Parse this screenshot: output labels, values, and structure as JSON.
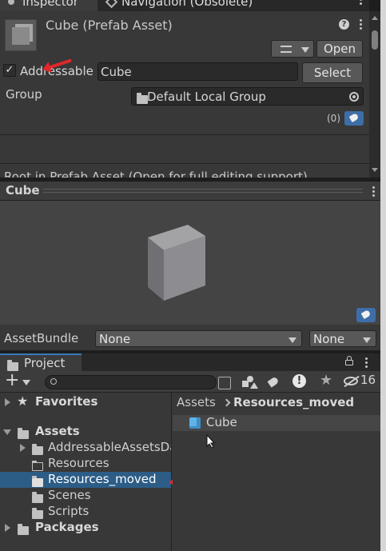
{
  "inspector": {
    "tab_inspector": "Inspector",
    "tab_navigation": "Navigation (Obsolete)",
    "header_title": "Cube (Prefab Asset)",
    "open_button": "Open",
    "addressable_label": "Addressable",
    "addressable_checked": true,
    "address_value": "Cube",
    "select_button": "Select",
    "group_label": "Group",
    "group_value": "Default Local Group",
    "label_count": "(0)",
    "root_notice": "Root in Prefab Asset (Open for full editing support)",
    "preview_title": "Cube",
    "assetbundle_label": "AssetBundle",
    "assetbundle_value": "None",
    "assetbundle_variant": "None"
  },
  "project": {
    "tab_label": "Project",
    "plus_label": "+",
    "search_placeholder": "",
    "hidden_count": "16",
    "tree": [
      {
        "label": "Favorites",
        "icon": "star-icon",
        "bold": true
      },
      {
        "label": "Assets",
        "icon": "folder-open-icon",
        "bold": true
      },
      {
        "label": "AddressableAssetsData",
        "icon": "folder-icon",
        "bold": false
      },
      {
        "label": "Resources",
        "icon": "folder-empty-icon",
        "bold": false
      },
      {
        "label": "Resources_moved",
        "icon": "folder-icon",
        "bold": false,
        "selected": true
      },
      {
        "label": "Scenes",
        "icon": "folder-icon",
        "bold": false
      },
      {
        "label": "Scripts",
        "icon": "folder-icon",
        "bold": false
      },
      {
        "label": "Packages",
        "icon": "folder-icon",
        "bold": true
      }
    ],
    "breadcrumb_root": "Assets",
    "breadcrumb_current": "Resources_moved",
    "files": [
      {
        "label": "Cube",
        "icon": "prefab-cube-icon"
      }
    ]
  },
  "colors": {
    "selection": "#2c5d87",
    "label_tag": "#3d6ea8",
    "annotation_arrow": "#e0272a"
  }
}
